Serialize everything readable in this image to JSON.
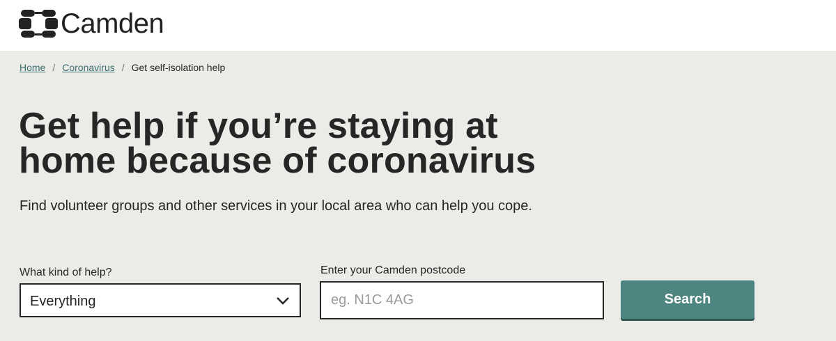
{
  "header": {
    "logo_text": "Camden",
    "logo_icon": "camden-logo-mark"
  },
  "breadcrumb": {
    "items": [
      "Home",
      "Coronavirus"
    ],
    "separator": "/",
    "current": "Get self-isolation help"
  },
  "main": {
    "title": "Get help if you’re staying at home because of coronavirus",
    "intro": "Find volunteer groups and other services in your local area who can help you cope."
  },
  "form": {
    "help_label": "What kind of help?",
    "help_selected": "Everything",
    "postcode_label": "Enter your Camden postcode",
    "postcode_placeholder": "eg. N1C 4AG",
    "postcode_value": "",
    "search_label": "Search"
  },
  "colors": {
    "page_background": "#ebebe7",
    "accent": "#4e8580",
    "link": "#3a6e6e",
    "text": "#262626"
  }
}
